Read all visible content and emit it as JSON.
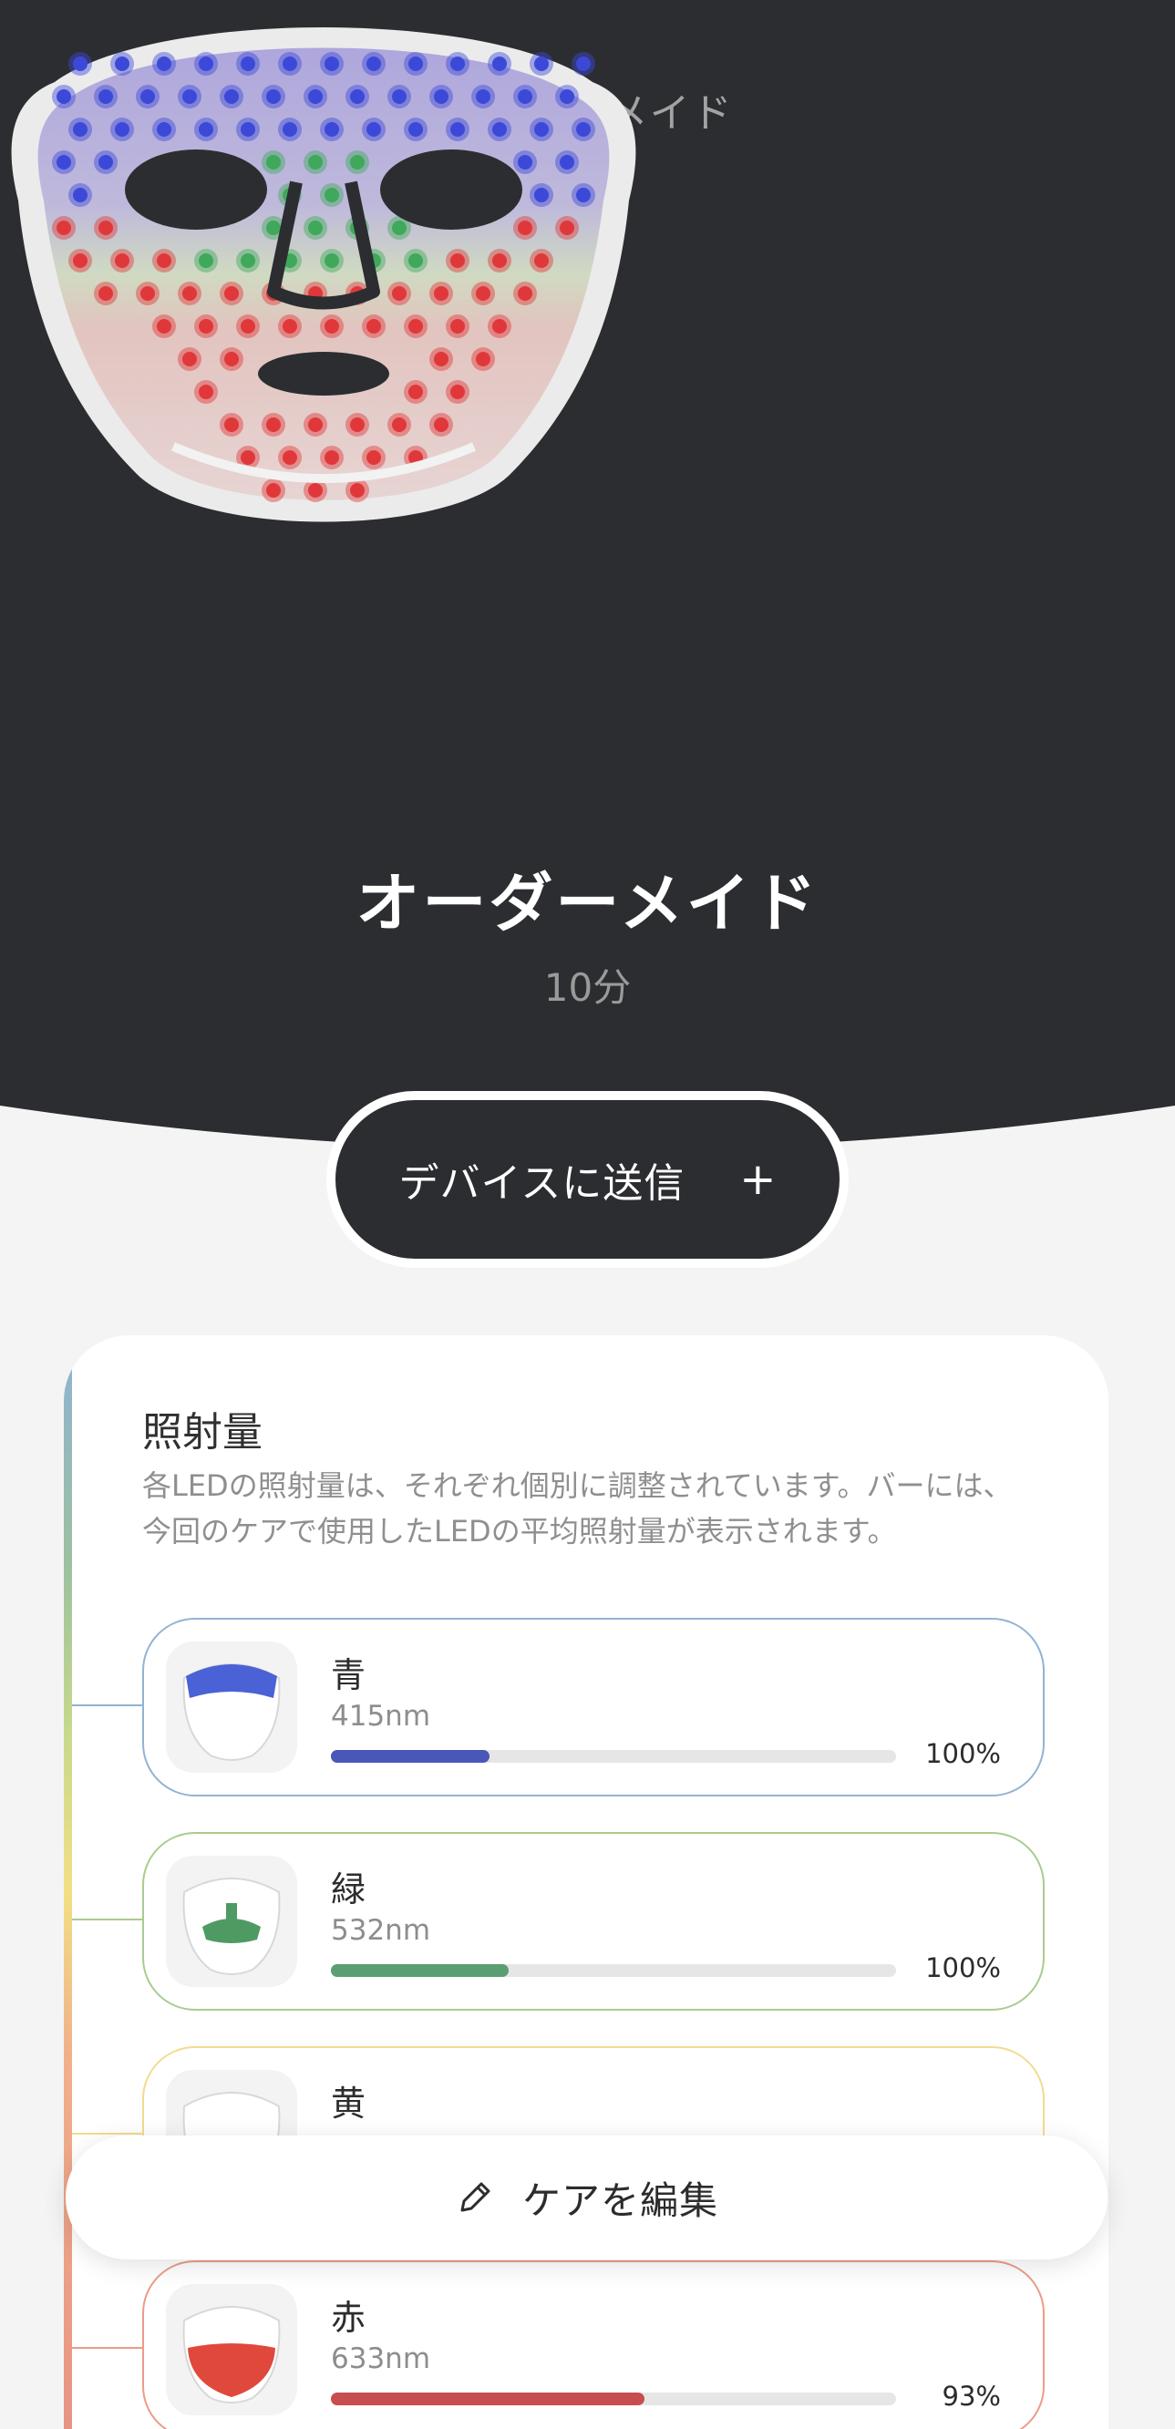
{
  "header": {
    "title": "オーダーメイド",
    "back_icon": "chevron-left-icon"
  },
  "program": {
    "name": "オーダーメイド",
    "duration": "10分"
  },
  "send_button": {
    "label": "デバイスに送信",
    "icon": "plus-icon",
    "icon_glyph": "+"
  },
  "irradiation": {
    "title": "照射量",
    "description": "各LEDの照射量は、それぞれ個別に調整されています。バーには、今回のケアで使用したLEDの平均照射量が表示されます。",
    "items": [
      {
        "name": "青",
        "wavelength": "415nm",
        "percent_label": "100%",
        "level": 0.28,
        "color": "#4957b8",
        "border": "#91b3d4"
      },
      {
        "name": "緑",
        "wavelength": "532nm",
        "percent_label": "100%",
        "level": 0.315,
        "color": "#5b9e71",
        "border": "#a8cc8f"
      },
      {
        "name": "黄",
        "wavelength": "",
        "percent_label": "",
        "level": 0,
        "color": "#e3c24d",
        "border": "#f1dc8f"
      },
      {
        "name": "赤",
        "wavelength": "633nm",
        "percent_label": "93%",
        "level": 0.555,
        "color": "#c74e4e",
        "border": "#ec9c87"
      }
    ]
  },
  "edit_button": {
    "label": "ケアを編集",
    "icon": "pencil-icon"
  },
  "colors": {
    "header_bg": "#2c2d31",
    "page_bg": "#f4f4f4",
    "card_bg": "#ffffff"
  }
}
